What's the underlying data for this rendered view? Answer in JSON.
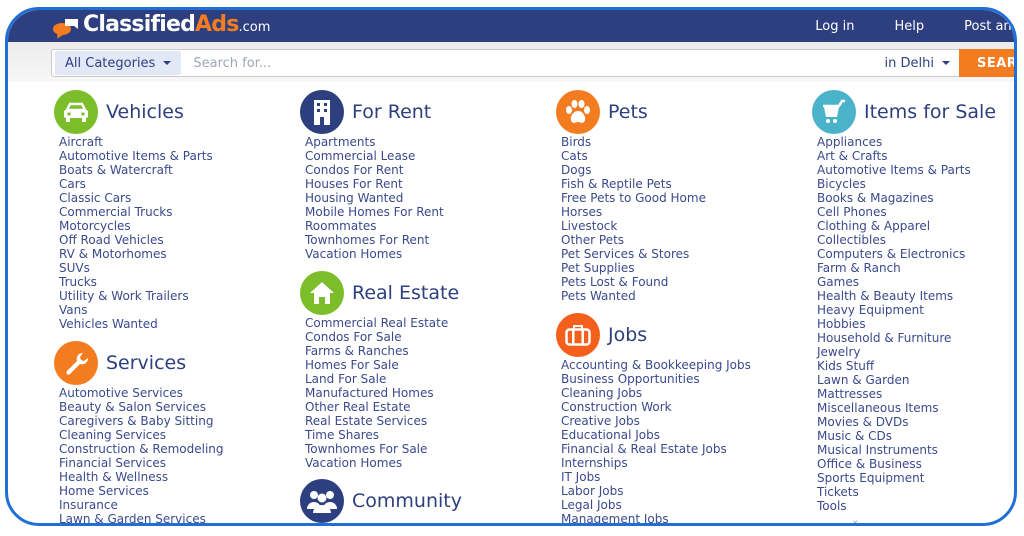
{
  "header": {
    "logo": {
      "part1": "Classified",
      "part2": "Ads",
      "part3": ".com"
    },
    "nav": [
      "Log in",
      "Help",
      "Post an ad"
    ]
  },
  "search": {
    "category": "All Categories",
    "placeholder": "Search for...",
    "value": "",
    "location": "in Delhi",
    "button": "SEARCH"
  },
  "colors": {
    "navy": "#2d3f7e",
    "orange": "#f47c20",
    "green": "#7cbd2a",
    "teal": "#4bb3c9",
    "frame": "#1f6fd6"
  },
  "sections": {
    "vehicles": {
      "title": "Vehicles",
      "icon": "car-icon",
      "items": [
        "Aircraft",
        "Automotive Items & Parts",
        "Boats & Watercraft",
        "Cars",
        "Classic Cars",
        "Commercial Trucks",
        "Motorcycles",
        "Off Road Vehicles",
        "RV & Motorhomes",
        "SUVs",
        "Trucks",
        "Utility & Work Trailers",
        "Vans",
        "Vehicles Wanted"
      ]
    },
    "services": {
      "title": "Services",
      "icon": "wrench-icon",
      "items": [
        "Automotive Services",
        "Beauty & Salon Services",
        "Caregivers & Baby Sitting",
        "Cleaning Services",
        "Construction & Remodeling",
        "Financial Services",
        "Health & Wellness",
        "Home Services",
        "Insurance",
        "Lawn & Garden Services"
      ]
    },
    "for_rent": {
      "title": "For Rent",
      "icon": "building-icon",
      "items": [
        "Apartments",
        "Commercial Lease",
        "Condos For Rent",
        "Houses For Rent",
        "Housing Wanted",
        "Mobile Homes For Rent",
        "Roommates",
        "Townhomes For Rent",
        "Vacation Homes"
      ]
    },
    "real_estate": {
      "title": "Real Estate",
      "icon": "house-icon",
      "items": [
        "Commercial Real Estate",
        "Condos For Sale",
        "Farms & Ranches",
        "Homes For Sale",
        "Land For Sale",
        "Manufactured Homes",
        "Other Real Estate",
        "Real Estate Services",
        "Time Shares",
        "Townhomes For Sale",
        "Vacation Homes"
      ]
    },
    "community": {
      "title": "Community",
      "icon": "people-icon",
      "items": []
    },
    "pets": {
      "title": "Pets",
      "icon": "paw-icon",
      "items": [
        "Birds",
        "Cats",
        "Dogs",
        "Fish & Reptile Pets",
        "Free Pets to Good Home",
        "Horses",
        "Livestock",
        "Other Pets",
        "Pet Services & Stores",
        "Pet Supplies",
        "Pets Lost & Found",
        "Pets Wanted"
      ]
    },
    "jobs": {
      "title": "Jobs",
      "icon": "briefcase-icon",
      "items": [
        "Accounting & Bookkeeping Jobs",
        "Business Opportunities",
        "Cleaning Jobs",
        "Construction Work",
        "Creative Jobs",
        "Educational Jobs",
        "Financial & Real Estate Jobs",
        "Internships",
        "IT Jobs",
        "Labor Jobs",
        "Legal Jobs",
        "Management Jobs"
      ]
    },
    "items_for_sale": {
      "title": "Items for Sale",
      "icon": "cart-icon",
      "items": [
        "Appliances",
        "Art & Crafts",
        "Automotive Items & Parts",
        "Bicycles",
        "Books & Magazines",
        "Cell Phones",
        "Clothing & Apparel",
        "Collectibles",
        "Computers & Electronics",
        "Farm & Ranch",
        "Games",
        "Health & Beauty Items",
        "Heavy Equipment",
        "Hobbies",
        "Household & Furniture",
        "Jewelry",
        "Kids Stuff",
        "Lawn & Garden",
        "Mattresses",
        "Miscellaneous Items",
        "Movies & DVDs",
        "Music & CDs",
        "Musical Instruments",
        "Office & Business",
        "Sports Equipment",
        "Tickets",
        "Tools"
      ]
    }
  },
  "more_indicator": "⌄"
}
